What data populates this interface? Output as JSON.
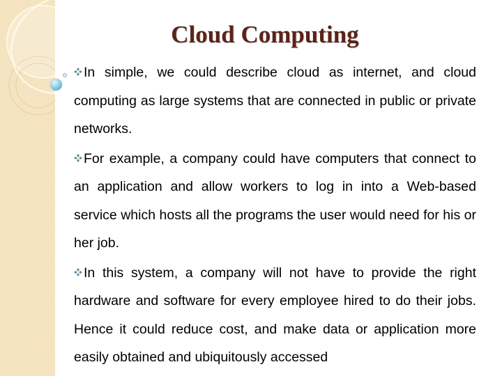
{
  "slide": {
    "title": "Cloud Computing",
    "bullet_icon": "four-diamond-bullet-icon",
    "accent_color": "#5a231a",
    "bullet_color": "#5b8f9a",
    "panel_color": "#f2dfb6",
    "bullets": [
      {
        "text": "In simple, we could describe cloud as internet, and cloud computing as large systems that are connected in public or private networks."
      },
      {
        "text": "For example, a company could have computers that connect to an application and allow workers to log in into a Web-based service which hosts all the programs the user would need for his or her job."
      },
      {
        "text": "In this system, a company will not have to provide the right hardware and software for every employee hired to do their jobs. Hence it could reduce cost, and make data or application more easily obtained and ubiquitously accessed"
      }
    ]
  }
}
